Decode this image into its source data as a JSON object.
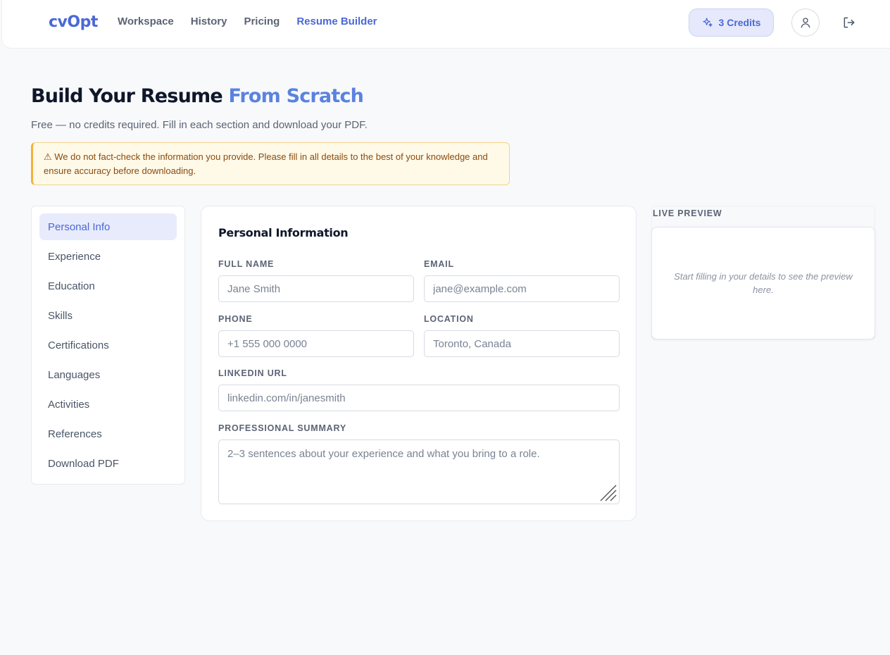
{
  "header": {
    "logo": "cvOpt",
    "nav": [
      {
        "label": "Workspace",
        "active": false
      },
      {
        "label": "History",
        "active": false
      },
      {
        "label": "Pricing",
        "active": false
      },
      {
        "label": "Resume Builder",
        "active": true
      }
    ],
    "credits_label": "3 Credits",
    "credits_icon": "sparkles-icon",
    "profile_icon": "user-icon",
    "logout_icon": "logout-icon"
  },
  "page": {
    "title_main": "Build Your Resume",
    "title_accent": "From Scratch",
    "subtitle": "Free — no credits required. Fill in each section and download your PDF.",
    "warning": "⚠ We do not fact-check the information you provide. Please fill in all details to the best of your knowledge and ensure accuracy before downloading."
  },
  "sidebar": {
    "items": [
      {
        "label": "Personal Info",
        "active": true
      },
      {
        "label": "Experience",
        "active": false
      },
      {
        "label": "Education",
        "active": false
      },
      {
        "label": "Skills",
        "active": false
      },
      {
        "label": "Certifications",
        "active": false
      },
      {
        "label": "Languages",
        "active": false
      },
      {
        "label": "Activities",
        "active": false
      },
      {
        "label": "References",
        "active": false
      },
      {
        "label": "Download PDF",
        "active": false
      }
    ]
  },
  "form": {
    "title": "Personal Information",
    "full_name": {
      "label": "FULL NAME",
      "value": "",
      "placeholder": "Jane Smith"
    },
    "email": {
      "label": "EMAIL",
      "value": "",
      "placeholder": "jane@example.com"
    },
    "phone": {
      "label": "PHONE",
      "value": "",
      "placeholder": "+1 555 000 0000"
    },
    "location": {
      "label": "LOCATION",
      "value": "",
      "placeholder": "Toronto, Canada"
    },
    "linkedin": {
      "label": "LINKEDIN URL",
      "value": "",
      "placeholder": "linkedin.com/in/janesmith"
    },
    "summary": {
      "label": "PROFESSIONAL SUMMARY",
      "value": "",
      "placeholder": "2–3 sentences about your experience and what you bring to a role."
    }
  },
  "preview": {
    "label": "LIVE PREVIEW",
    "empty_text": "Start filling in your details to see the preview here."
  },
  "colors": {
    "accent": "#4b68d6",
    "title_accent": "#5b82e0",
    "warning_bg": "#fff9e8",
    "warning_border": "#f2b23b",
    "warning_text": "#8a4b0d",
    "active_bg": "#e8ebfb"
  }
}
